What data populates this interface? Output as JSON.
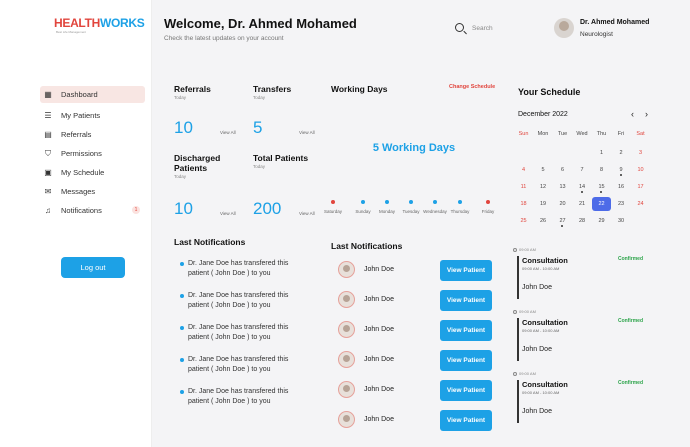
{
  "brand": {
    "part1": "HEALTH",
    "part2": "WORKS",
    "tagline": "Best Life Management"
  },
  "sidebar": {
    "items": [
      {
        "label": "Dashboard"
      },
      {
        "label": "My Patients"
      },
      {
        "label": "Referrals"
      },
      {
        "label": "Permissions"
      },
      {
        "label": "My Schedule"
      },
      {
        "label": "Messages"
      },
      {
        "label": "Notifications",
        "badge": "1"
      }
    ],
    "logout": "Log out"
  },
  "header": {
    "welcome": "Welcome, Dr. Ahmed Mohamed",
    "subtitle": "Check the latest updates on your account",
    "search_placeholder": "Search",
    "user_name": "Dr. Ahmed Mohamed",
    "user_role": "Neurologist"
  },
  "stats": {
    "referrals": {
      "title": "Referrals",
      "sub": "Today",
      "value": "10",
      "link": "View All"
    },
    "transfers": {
      "title": "Transfers",
      "sub": "Today",
      "value": "5",
      "link": "View All"
    },
    "discharged": {
      "title1": "Discharged",
      "title2": "Patients",
      "sub": "Today",
      "value": "10",
      "link": "View All"
    },
    "total": {
      "title": "Total Patients",
      "sub": "Today",
      "value": "200",
      "link": "View All"
    }
  },
  "working_days": {
    "title": "Working Days",
    "change": "Change Schedule",
    "summary": "5 Working Days",
    "days": [
      {
        "name": "Saturday",
        "color": "#e1453d"
      },
      {
        "name": "Sunday",
        "color": "#1da1e6"
      },
      {
        "name": "Monday",
        "color": "#1da1e6"
      },
      {
        "name": "Tuesday",
        "color": "#1da1e6"
      },
      {
        "name": "Wednesday",
        "color": "#1da1e6"
      },
      {
        "name": "Thursday",
        "color": "#1da1e6"
      },
      {
        "name": "Friday",
        "color": "#e1453d"
      }
    ]
  },
  "notifications_left": {
    "title": "Last Notifications",
    "items": [
      {
        "line1": "Dr. Jane Doe has transfered this",
        "line2": "patient ( John Doe ) to you"
      },
      {
        "line1": "Dr. Jane Doe has transfered this",
        "line2": "patient ( John Doe ) to you"
      },
      {
        "line1": "Dr. Jane Doe has transfered this",
        "line2": "patient ( John Doe ) to you"
      },
      {
        "line1": "Dr. Jane Doe has transfered this",
        "line2": "patient ( John Doe ) to you"
      },
      {
        "line1": "Dr. Jane Doe has transfered this",
        "line2": "patient ( John Doe ) to you"
      }
    ]
  },
  "notifications_right": {
    "title": "Last Notifications",
    "button": "View Patient",
    "patients": [
      "John Doe",
      "John Doe",
      "John Doe",
      "John Doe",
      "John Doe",
      "John Doe"
    ]
  },
  "schedule": {
    "title": "Your Schedule",
    "month": "December 2022",
    "prev": "‹",
    "next": "›",
    "weekdays": [
      "Sun",
      "Mon",
      "Tue",
      "Wed",
      "Thu",
      "Fri",
      "Sat"
    ],
    "weekday_colors": [
      "#e1453d",
      "#444",
      "#444",
      "#444",
      "#444",
      "#444",
      "#e1453d"
    ],
    "weeks": [
      [
        "",
        "",
        "",
        "",
        "1",
        "2",
        "3"
      ],
      [
        "4",
        "5",
        "6",
        "7",
        "8",
        "9",
        "10"
      ],
      [
        "11",
        "12",
        "13",
        "14",
        "15",
        "16",
        "17"
      ],
      [
        "18",
        "19",
        "20",
        "21",
        "22",
        "23",
        "24"
      ],
      [
        "25",
        "26",
        "27",
        "28",
        "29",
        "30",
        ""
      ]
    ],
    "selected": "22",
    "event_days": [
      "9",
      "14",
      "15",
      "27"
    ],
    "appointments": [
      {
        "time_label": "09:00 AM",
        "title": "Consultation",
        "range": "09:00 AM - 10:00 AM",
        "status": "Confirmed",
        "patient": "John Doe"
      },
      {
        "time_label": "09:00 AM",
        "title": "Consultation",
        "range": "09:00 AM - 10:00 AM",
        "status": "Confirmed",
        "patient": "John Doe"
      },
      {
        "time_label": "09:00 AM",
        "title": "Consultation",
        "range": "09:00 AM - 10:00 AM",
        "status": "Confirmed",
        "patient": "John Doe"
      }
    ]
  }
}
